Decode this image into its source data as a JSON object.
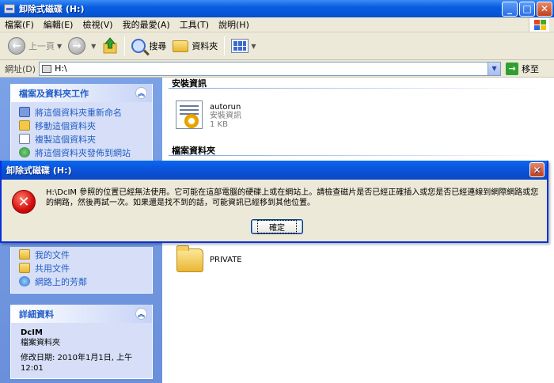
{
  "window": {
    "title": "卸除式磁碟 (H:)"
  },
  "menu": [
    "檔案(F)",
    "編輯(E)",
    "檢視(V)",
    "我的最愛(A)",
    "工具(T)",
    "說明(H)"
  ],
  "toolbar": {
    "back": "上一頁",
    "search": "搜尋",
    "folders": "資料夾"
  },
  "address": {
    "label": "網址(D)",
    "value": "H:\\",
    "go": "移至"
  },
  "tasks_panel": {
    "title": "檔案及資料夾工作",
    "items": [
      "將這個資料夾重新命名",
      "移動這個資料夾",
      "複製這個資料夾",
      "將這個資料夾發佈到網站"
    ]
  },
  "places_panel": {
    "items": [
      "我的文件",
      "共用文件",
      "網路上的芳鄰"
    ]
  },
  "details_panel": {
    "title": "詳細資料",
    "name": "DcIM",
    "type": "檔案資料夾",
    "modified": "修改日期: 2010年1月1日, 上午 12:01"
  },
  "content": {
    "group1": "安裝資訊",
    "file": {
      "name": "autorun",
      "type": "安裝資訊",
      "size": "1 KB"
    },
    "group2": "檔案資料夾",
    "folder": {
      "name": "PRIVATE"
    }
  },
  "dialog": {
    "title": "卸除式磁碟 (H:)",
    "message": "H:\\DcIM 參照的位置已經無法使用。它可能在這部電腦的硬碟上或在網站上。請檢查磁片是否已經正確插入或您是否已經連線到網際網路或您的網路，然後再試一次。如果還是找不到的話，可能資訊已經移到其他位置。",
    "ok": "確定"
  }
}
